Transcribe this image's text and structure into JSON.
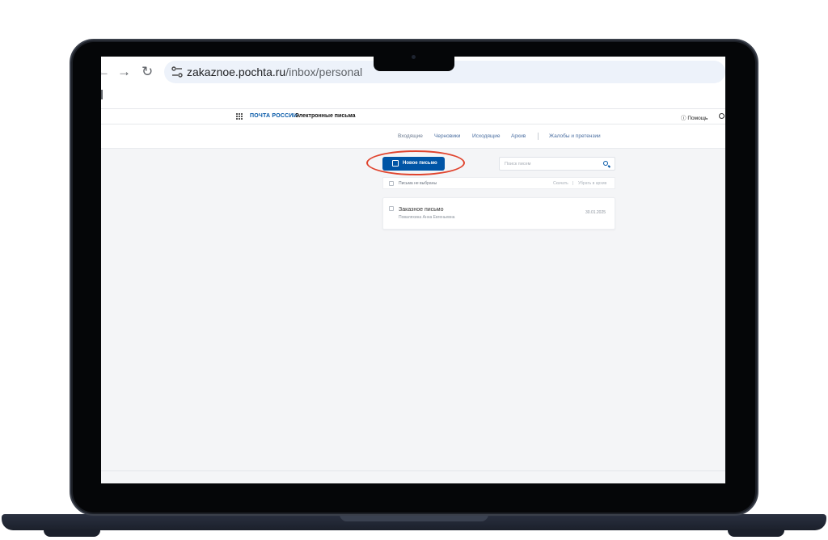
{
  "browser": {
    "url_host": "zakaznoe.pochta.ru",
    "url_path": "/inbox/personal"
  },
  "header": {
    "brand": "ПОЧТА РОССИИ",
    "service": "Электронные письма",
    "help": "Помощь"
  },
  "nav": {
    "tabs": [
      "Входящие",
      "Черновики",
      "Исходящие",
      "Архив"
    ],
    "complaints": "Жалобы и претензии"
  },
  "actions": {
    "new_letter": "Новое письмо",
    "search_placeholder": "Поиск писем"
  },
  "toolbar": {
    "selection": "Письма не выбраны",
    "download": "Скачать",
    "archive": "Убрать в архив"
  },
  "letters": [
    {
      "subject": "Заказное письмо",
      "sender": "Поваляхина Анна Евгеньевна",
      "date": "30.01.2025"
    }
  ],
  "colors": {
    "brand_blue": "#0055a6",
    "highlight": "#e0442e",
    "laptop_body": "#1c1f26"
  }
}
